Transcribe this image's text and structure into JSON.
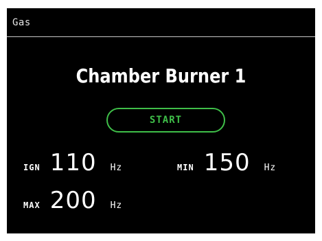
{
  "header": {
    "title": "Gas"
  },
  "device": {
    "name": "Chamber Burner 1"
  },
  "controls": {
    "start_label": "START"
  },
  "params": {
    "ign": {
      "label": "IGN",
      "value": "110",
      "unit": "Hz"
    },
    "min": {
      "label": "MIN",
      "value": "150",
      "unit": "Hz"
    },
    "max": {
      "label": "MAX",
      "value": "200",
      "unit": "Hz"
    }
  },
  "colors": {
    "background": "#000000",
    "text": "#ffffff",
    "accent": "#3fbf49",
    "divider": "#c8c8c8"
  }
}
